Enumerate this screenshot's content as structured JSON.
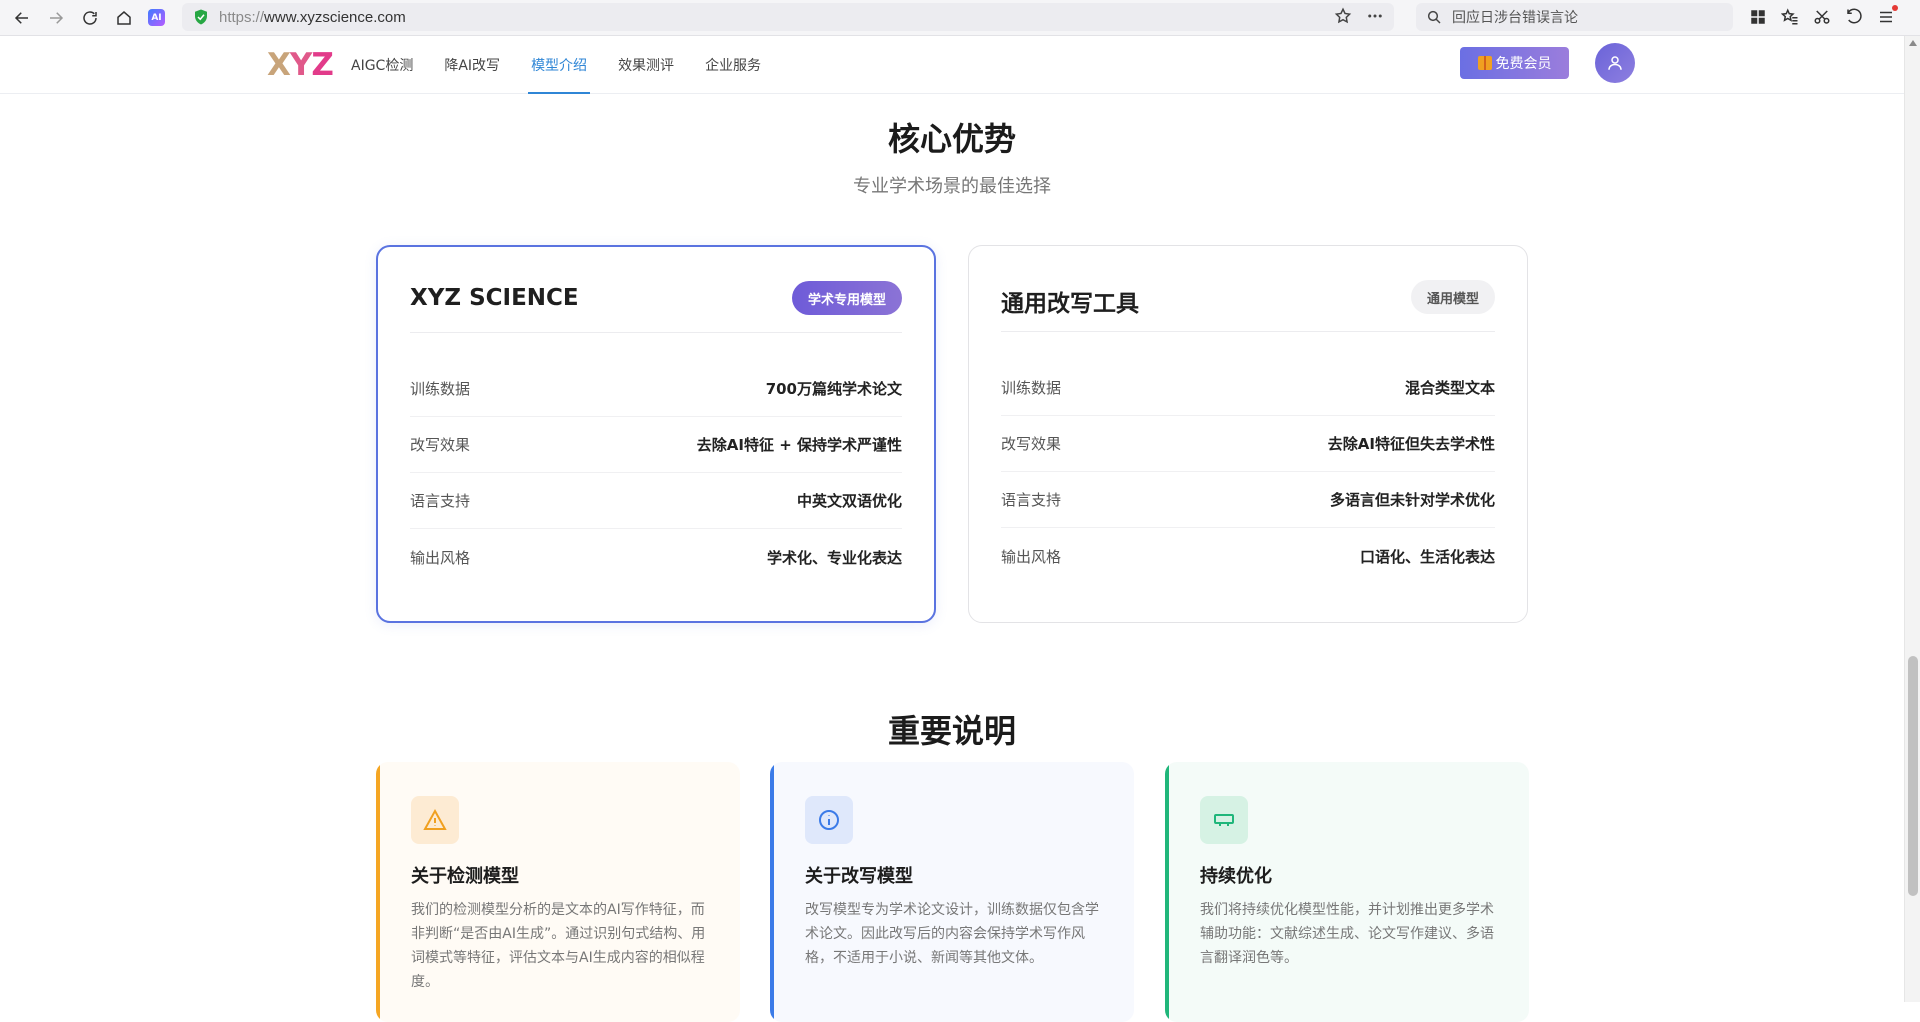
{
  "browser": {
    "url_proto": "https://",
    "url_host": "www.xyzscience.com",
    "search_placeholder": "回应日涉台错误言论",
    "ext_label": "AI"
  },
  "header": {
    "logo": {
      "l1": "X",
      "l2": "Y",
      "l3": "Z"
    },
    "menu": [
      {
        "label": "AIGC检测",
        "active": false
      },
      {
        "label": "降AI改写",
        "active": false
      },
      {
        "label": "模型介绍",
        "active": true
      },
      {
        "label": "效果测评",
        "active": false
      },
      {
        "label": "企业服务",
        "active": false
      }
    ],
    "vip_label": "免费会员",
    "colors": {
      "active": "#2f86d6",
      "vip_start": "#6b6fe3",
      "vip_end": "#9b7ddc"
    }
  },
  "advantages": {
    "title": "核心优势",
    "subtitle": "专业学术场景的最佳选择",
    "cards": [
      {
        "title": "XYZ SCIENCE",
        "badge": "学术专用模型",
        "rows": [
          {
            "k": "训练数据",
            "v": "700万篇纯学术论文"
          },
          {
            "k": "改写效果",
            "v": "去除AI特征 + 保持学术严谨性"
          },
          {
            "k": "语言支持",
            "v": "中英文双语优化"
          },
          {
            "k": "输出风格",
            "v": "学术化、专业化表达"
          }
        ]
      },
      {
        "title": "通用改写工具",
        "badge": "通用模型",
        "rows": [
          {
            "k": "训练数据",
            "v": "混合类型文本"
          },
          {
            "k": "改写效果",
            "v": "去除AI特征但失去学术性"
          },
          {
            "k": "语言支持",
            "v": "多语言但未针对学术优化"
          },
          {
            "k": "输出风格",
            "v": "口语化、生活化表达"
          }
        ]
      }
    ]
  },
  "notes": {
    "title": "重要说明",
    "items": [
      {
        "icon": "warning-icon",
        "title": "关于检测模型",
        "text": "我们的检测模型分析的是文本的AI写作特征，而非判断“是否由AI生成”。通过识别句式结构、用词模式等特征，评估文本与AI生成内容的相似程度。",
        "accent": "#f5a623"
      },
      {
        "icon": "info-icon",
        "title": "关于改写模型",
        "text": "改写模型专为学术论文设计，训练数据仅包含学术论文。因此改写后的内容会保持学术写作风格，不适用于小说、新闻等其他文体。",
        "accent": "#3b7be8"
      },
      {
        "icon": "keyboard-icon",
        "title": "持续优化",
        "text": "我们将持续优化模型性能，并计划推出更多学术辅助功能：文献综述生成、论文写作建议、多语言翻译润色等。",
        "accent": "#1fb67a"
      }
    ]
  }
}
